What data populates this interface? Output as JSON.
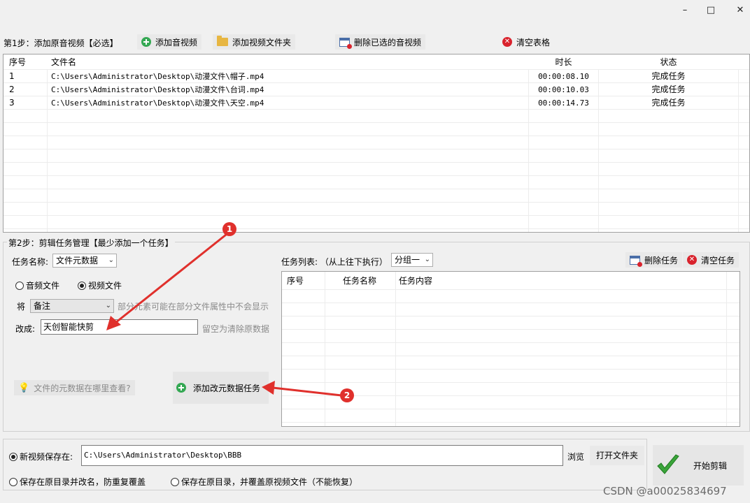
{
  "window": {
    "minimize": "–",
    "maximize": "□",
    "close": "✕"
  },
  "step1": {
    "label": "第1步：添加原音视频【必选】",
    "add_audio": "添加音视频",
    "add_folder": "添加视频文件夹",
    "delete_selected": "删除已选的音视频",
    "clear_table": "清空表格"
  },
  "file_table": {
    "headers": {
      "index": "序号",
      "name": "文件名",
      "duration": "时长",
      "status": "状态"
    },
    "rows": [
      {
        "index": "1",
        "name": "C:\\Users\\Administrator\\Desktop\\动漫文件\\帽子.mp4",
        "duration": "00:00:08.10",
        "status": "完成任务"
      },
      {
        "index": "2",
        "name": "C:\\Users\\Administrator\\Desktop\\动漫文件\\台词.mp4",
        "duration": "00:00:10.03",
        "status": "完成任务"
      },
      {
        "index": "3",
        "name": "C:\\Users\\Administrator\\Desktop\\动漫文件\\天空.mp4",
        "duration": "00:00:14.73",
        "status": "完成任务"
      }
    ]
  },
  "step2": {
    "label": "第2步：剪辑任务管理【最少添加一个任务】",
    "task_name_label": "任务名称:",
    "task_name_value": "文件元数据",
    "radio_audio": "音频文件",
    "radio_video": "视频文件",
    "field_prefix": "将",
    "field_value": "备注",
    "field_hint": "部分元素可能在部分文件属性中不会显示",
    "change_label": "改成:",
    "change_value": "天创智能快剪",
    "change_hint": "留空为清除原数据",
    "help_text": "文件的元数据在哪里查看?",
    "add_task": "添加改元数据任务",
    "task_list_label": "任务列表: （从上往下执行）",
    "group_value": "分组一",
    "delete_task": "删除任务",
    "clear_tasks": "清空任务",
    "task_headers": {
      "index": "序号",
      "name": "任务名称",
      "content": "任务内容"
    }
  },
  "output": {
    "save_new_label": "新视频保存在:",
    "save_path": "C:\\Users\\Administrator\\Desktop\\BBB",
    "browse": "浏览",
    "open_folder": "打开文件夹",
    "save_rename": "保存在原目录并改名，防重复覆盖",
    "save_overwrite": "保存在原目录，并覆盖原视频文件（不能恢复）",
    "start": "开始剪辑"
  },
  "annotations": {
    "one": "1",
    "two": "2"
  },
  "watermark": "CSDN @a00025834697",
  "colors": {
    "accent_red": "#e0302c",
    "green_check": "#3aa43a"
  }
}
